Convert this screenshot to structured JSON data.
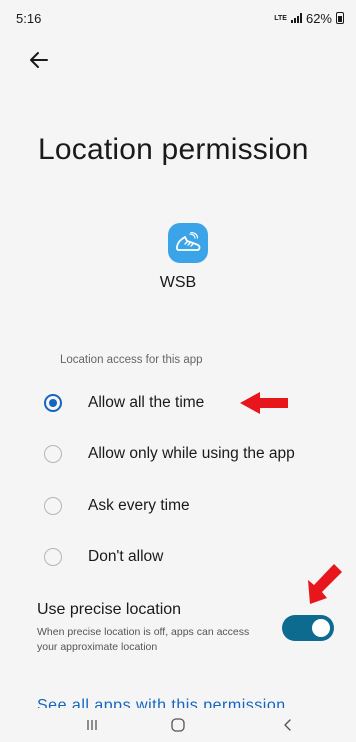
{
  "status_bar": {
    "time": "5:16",
    "network": "LTE",
    "battery": "62%"
  },
  "header": {
    "title": "Location permission"
  },
  "app": {
    "name": "WSB",
    "icon": "sneaker-icon",
    "icon_color": "#3ba3e8"
  },
  "permissions": {
    "section_label": "Location access for this app",
    "options": [
      {
        "label": "Allow all the time",
        "selected": true
      },
      {
        "label": "Allow only while using the app",
        "selected": false
      },
      {
        "label": "Ask every time",
        "selected": false
      },
      {
        "label": "Don't allow",
        "selected": false
      }
    ]
  },
  "precise_location": {
    "title": "Use precise location",
    "description": "When precise location is off, apps can access your approximate location",
    "enabled": true
  },
  "footer": {
    "see_all_link": "See all apps with this permission"
  },
  "nav": {
    "recents": "recents-icon",
    "home": "home-icon",
    "back": "back-icon"
  },
  "colors": {
    "accent": "#1565c0",
    "toggle_on": "#0d6b8f",
    "annotation_arrow": "#e8161c"
  }
}
